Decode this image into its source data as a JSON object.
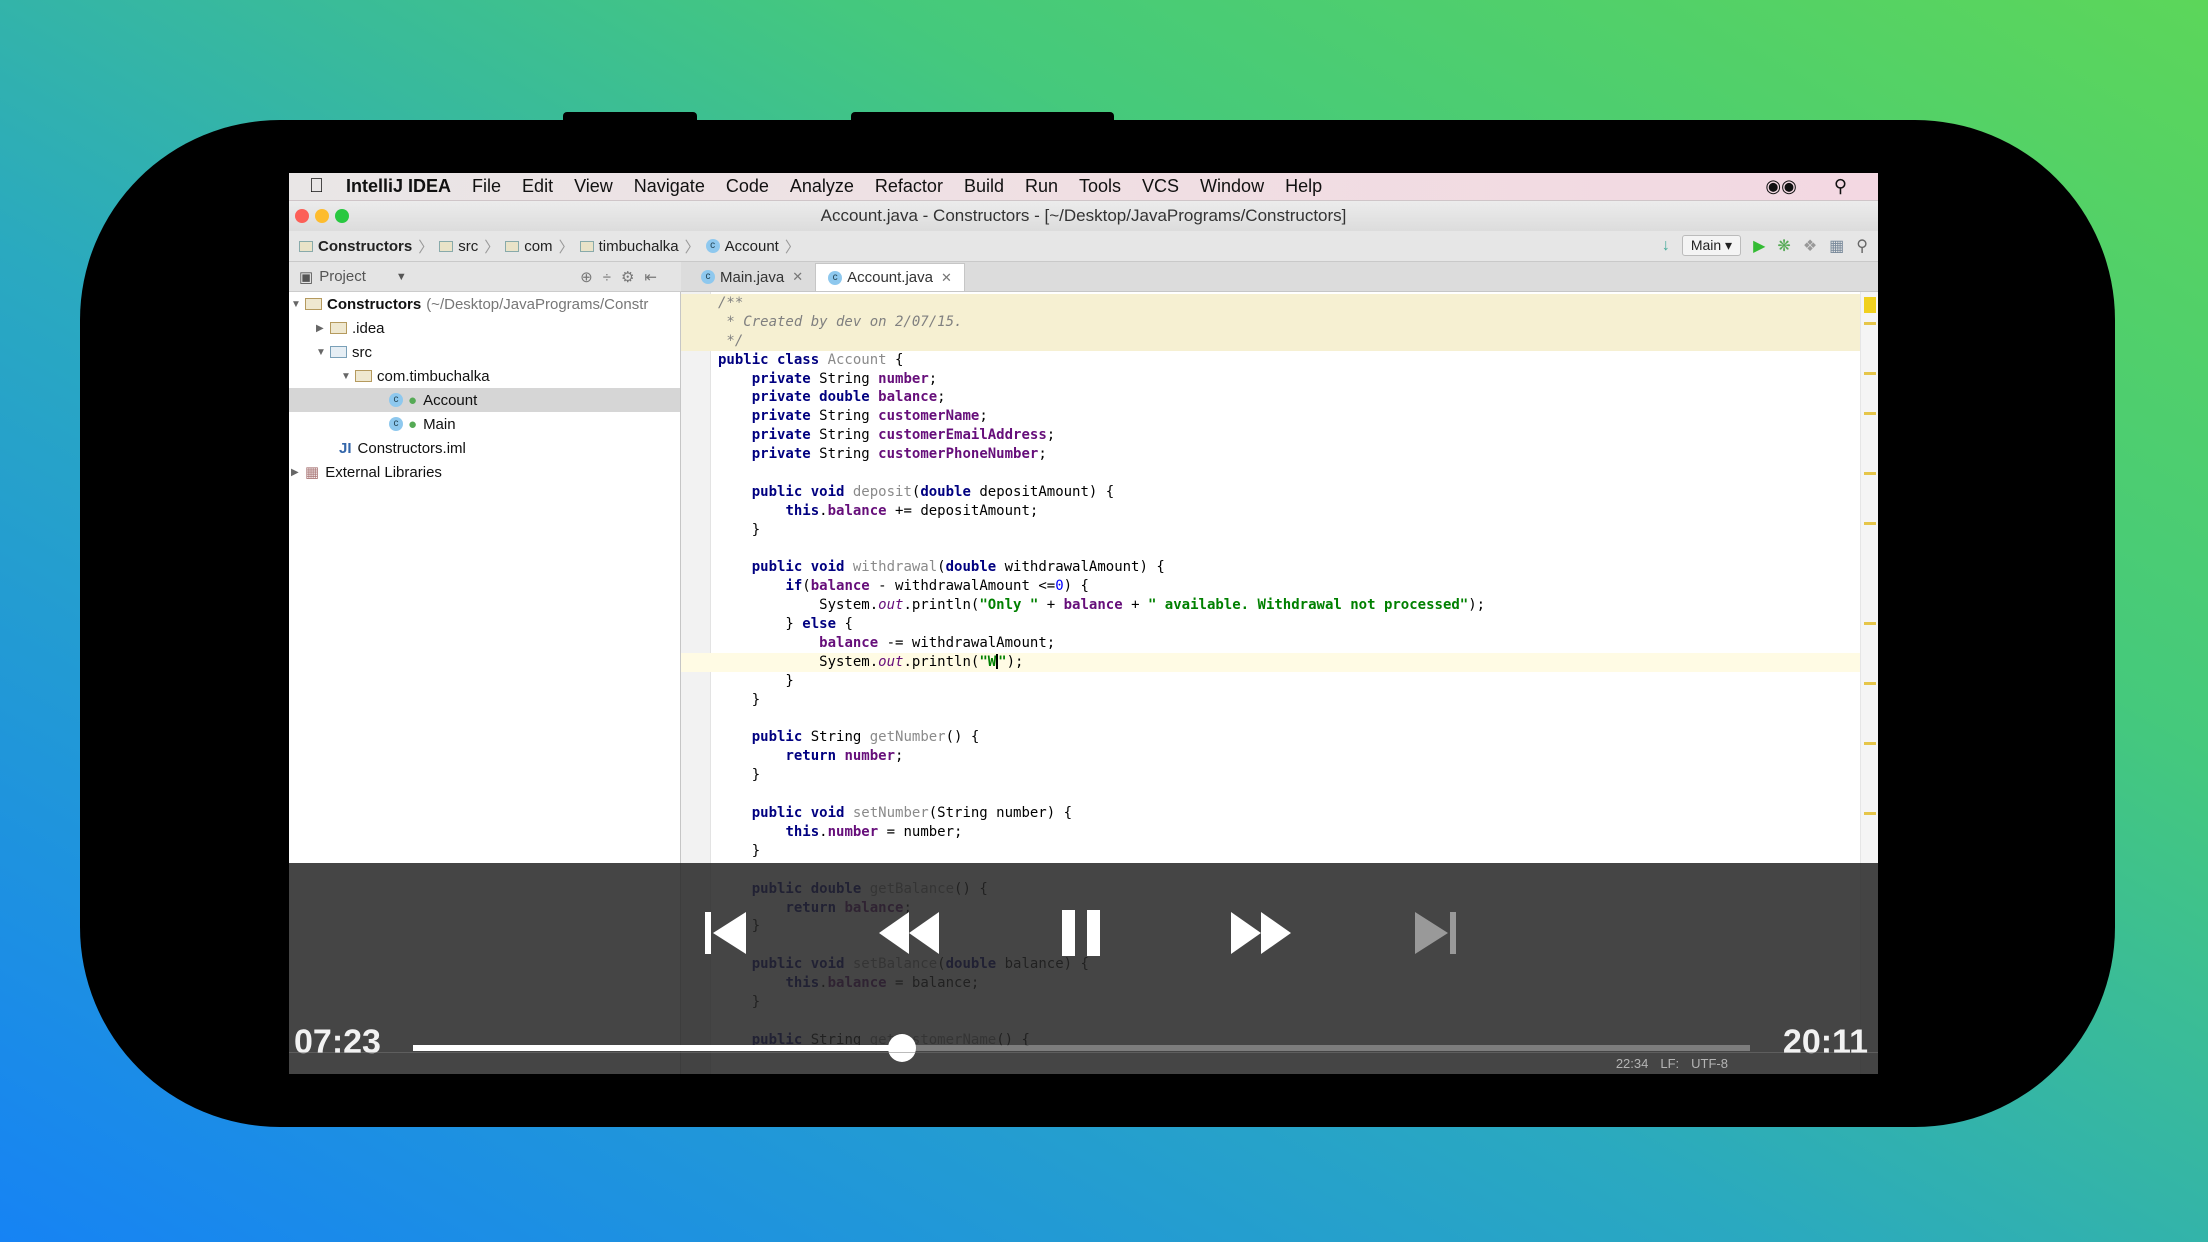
{
  "menubar": {
    "app": "IntelliJ IDEA",
    "items": [
      "File",
      "Edit",
      "View",
      "Navigate",
      "Code",
      "Analyze",
      "Refactor",
      "Build",
      "Run",
      "Tools",
      "VCS",
      "Window",
      "Help"
    ]
  },
  "window": {
    "title": "Account.java - Constructors - [~/Desktop/JavaPrograms/Constructors]"
  },
  "breadcrumb": [
    "Constructors",
    "src",
    "com",
    "timbuchalka",
    "Account"
  ],
  "toolbar": {
    "run_config": "Main"
  },
  "project_panel": {
    "label": "Project",
    "tree": [
      {
        "label": "Constructors",
        "suffix": "(~/Desktop/JavaPrograms/Constr",
        "expanded": true
      },
      {
        "label": ".idea",
        "expanded": false
      },
      {
        "label": "src",
        "expanded": true
      },
      {
        "label": "com.timbuchalka",
        "expanded": true
      },
      {
        "label": "Account",
        "selected": true
      },
      {
        "label": "Main"
      },
      {
        "label": "Constructors.iml"
      },
      {
        "label": "External Libraries",
        "expanded": false
      }
    ]
  },
  "tabs": [
    {
      "label": "Main.java",
      "active": false
    },
    {
      "label": "Account.java",
      "active": true
    }
  ],
  "editor": {
    "current_line": 19,
    "lines": [
      [
        [
          "c",
          "/**"
        ]
      ],
      [
        [
          "c",
          " * Created by dev on 2/07/15."
        ]
      ],
      [
        [
          "c",
          " */"
        ]
      ],
      [
        [
          "k",
          "public class "
        ],
        [
          "d",
          "Account"
        ],
        [
          "p",
          " {"
        ]
      ],
      [
        [
          "p",
          "    "
        ],
        [
          "k",
          "private "
        ],
        [
          "p",
          "String "
        ],
        [
          "f",
          "number"
        ],
        [
          "p",
          ";"
        ]
      ],
      [
        [
          "p",
          "    "
        ],
        [
          "k",
          "private double "
        ],
        [
          "f",
          "balance"
        ],
        [
          "p",
          ";"
        ]
      ],
      [
        [
          "p",
          "    "
        ],
        [
          "k",
          "private "
        ],
        [
          "p",
          "String "
        ],
        [
          "f",
          "customerName"
        ],
        [
          "p",
          ";"
        ]
      ],
      [
        [
          "p",
          "    "
        ],
        [
          "k",
          "private "
        ],
        [
          "p",
          "String "
        ],
        [
          "f",
          "customerEmailAddress"
        ],
        [
          "p",
          ";"
        ]
      ],
      [
        [
          "p",
          "    "
        ],
        [
          "k",
          "private "
        ],
        [
          "p",
          "String "
        ],
        [
          "f",
          "customerPhoneNumber"
        ],
        [
          "p",
          ";"
        ]
      ],
      [],
      [
        [
          "p",
          "    "
        ],
        [
          "k",
          "public void "
        ],
        [
          "d",
          "deposit"
        ],
        [
          "p",
          "("
        ],
        [
          "k",
          "double "
        ],
        [
          "p",
          "depositAmount) {"
        ]
      ],
      [
        [
          "p",
          "        "
        ],
        [
          "k",
          "this"
        ],
        [
          "p",
          "."
        ],
        [
          "f",
          "balance"
        ],
        [
          "p",
          " += depositAmount;"
        ]
      ],
      [
        [
          "p",
          "    }"
        ]
      ],
      [],
      [
        [
          "p",
          "    "
        ],
        [
          "k",
          "public void "
        ],
        [
          "d",
          "withdrawal"
        ],
        [
          "p",
          "("
        ],
        [
          "k",
          "double "
        ],
        [
          "p",
          "withdrawalAmount) {"
        ]
      ],
      [
        [
          "p",
          "        "
        ],
        [
          "k",
          "if"
        ],
        [
          "p",
          "("
        ],
        [
          "f",
          "balance"
        ],
        [
          "p",
          " - withdrawalAmount <="
        ],
        [
          "n",
          "0"
        ],
        [
          "p",
          ") {"
        ]
      ],
      [
        [
          "p",
          "            System."
        ],
        [
          "i",
          "out"
        ],
        [
          "p",
          ".println("
        ],
        [
          "s",
          "\"Only \""
        ],
        [
          "p",
          " + "
        ],
        [
          "f",
          "balance"
        ],
        [
          "p",
          " + "
        ],
        [
          "s",
          "\" available. Withdrawal not processed\""
        ],
        [
          "p",
          ");"
        ]
      ],
      [
        [
          "p",
          "        } "
        ],
        [
          "k",
          "else"
        ],
        [
          "p",
          " {"
        ]
      ],
      [
        [
          "p",
          "            "
        ],
        [
          "f",
          "balance"
        ],
        [
          "p",
          " -= withdrawalAmount;"
        ]
      ],
      [
        [
          "p",
          "            System."
        ],
        [
          "i",
          "out"
        ],
        [
          "p",
          ".println("
        ],
        [
          "s",
          "\"W"
        ],
        [
          "caret",
          ""
        ],
        [
          "s",
          "\""
        ],
        [
          "p",
          ");"
        ]
      ],
      [
        [
          "p",
          "        }"
        ]
      ],
      [
        [
          "p",
          "    }"
        ]
      ],
      [],
      [
        [
          "p",
          "    "
        ],
        [
          "k",
          "public "
        ],
        [
          "p",
          "String "
        ],
        [
          "d",
          "getNumber"
        ],
        [
          "p",
          "() {"
        ]
      ],
      [
        [
          "p",
          "        "
        ],
        [
          "k",
          "return "
        ],
        [
          "f",
          "number"
        ],
        [
          "p",
          ";"
        ]
      ],
      [
        [
          "p",
          "    }"
        ]
      ],
      [],
      [
        [
          "p",
          "    "
        ],
        [
          "k",
          "public void "
        ],
        [
          "d",
          "setNumber"
        ],
        [
          "p",
          "(String number) {"
        ]
      ],
      [
        [
          "p",
          "        "
        ],
        [
          "k",
          "this"
        ],
        [
          "p",
          "."
        ],
        [
          "f",
          "number"
        ],
        [
          "p",
          " = number;"
        ]
      ],
      [
        [
          "p",
          "    }"
        ]
      ],
      [],
      [
        [
          "p",
          "    "
        ],
        [
          "k",
          "public double "
        ],
        [
          "d",
          "getBalance"
        ],
        [
          "p",
          "() {"
        ]
      ],
      [
        [
          "p",
          "        "
        ],
        [
          "k",
          "return "
        ],
        [
          "f",
          "balance"
        ],
        [
          "p",
          ";"
        ]
      ],
      [
        [
          "p",
          "    }"
        ]
      ],
      [],
      [
        [
          "p",
          "    "
        ],
        [
          "k",
          "public void "
        ],
        [
          "d",
          "setBalance"
        ],
        [
          "p",
          "("
        ],
        [
          "k",
          "double "
        ],
        [
          "p",
          "balance) {"
        ]
      ],
      [
        [
          "p",
          "        "
        ],
        [
          "k",
          "this"
        ],
        [
          "p",
          "."
        ],
        [
          "f",
          "balance"
        ],
        [
          "p",
          " = balance;"
        ]
      ],
      [
        [
          "p",
          "    }"
        ]
      ],
      [],
      [
        [
          "p",
          "    "
        ],
        [
          "k",
          "public "
        ],
        [
          "p",
          "String "
        ],
        [
          "d",
          "getCustomerName"
        ],
        [
          "p",
          "() {"
        ]
      ]
    ]
  },
  "status": {
    "position": "22:34",
    "line_sep": "LF:",
    "encoding": "UTF-8"
  },
  "player": {
    "elapsed": "07:23",
    "duration": "20:11",
    "progress": 0.366,
    "controls": [
      "skip-previous",
      "rewind",
      "pause",
      "fast-forward",
      "skip-next"
    ]
  },
  "colors": {
    "keyword": "#000080",
    "field": "#660e7a",
    "string": "#008000",
    "comment": "#808080"
  }
}
